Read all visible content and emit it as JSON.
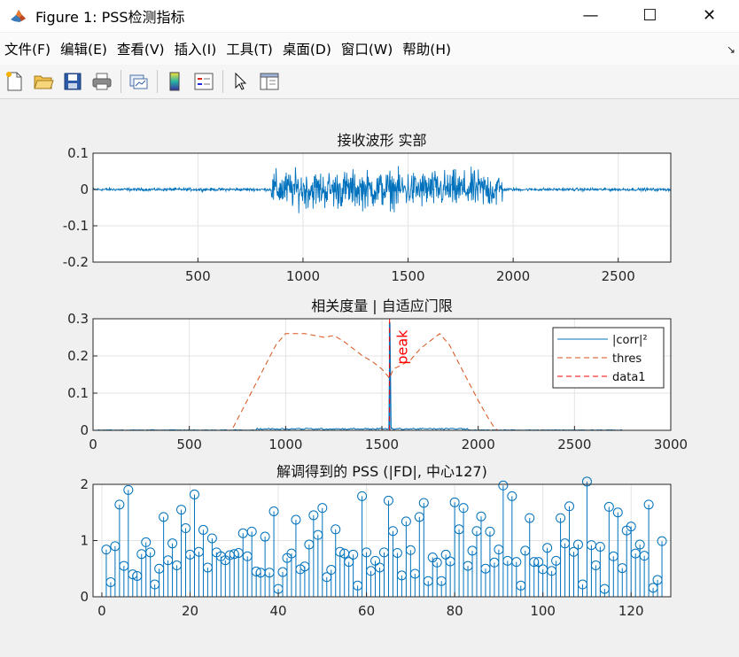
{
  "window": {
    "title": "Figure 1: PSS检测指标",
    "minimize": "—",
    "maximize": "☐",
    "close": "✕"
  },
  "menu": {
    "items": [
      "文件(F)",
      "编辑(E)",
      "查看(V)",
      "插入(I)",
      "工具(T)",
      "桌面(D)",
      "窗口(W)",
      "帮助(H)"
    ],
    "overflow_icon": "↘"
  },
  "toolbar": {
    "icons": [
      "new-figure-icon",
      "open-file-icon",
      "save-icon",
      "print-icon",
      "link-plot-icon",
      "colorbar-icon",
      "legend-icon",
      "pointer-icon",
      "property-editor-icon"
    ]
  },
  "colors": {
    "series_blue": "#0072bd",
    "series_orange": "#d95319",
    "peak_red": "#ff0000",
    "axes_bg": "#ffffff"
  },
  "chart_data": [
    {
      "type": "line",
      "title": "接收波形 实部",
      "xlim": [
        1,
        2750
      ],
      "ylim": [
        -0.2,
        0.1
      ],
      "xticks": [
        500,
        1000,
        1500,
        2000,
        2500
      ],
      "yticks": [
        -0.2,
        -0.1,
        0,
        0.1
      ],
      "xtick_labels": [
        "500",
        "1000",
        "1500",
        "2000",
        "2500"
      ],
      "ytick_labels": [
        "-0.2",
        "-0.1",
        "0",
        "0.1"
      ],
      "grid": true,
      "series": [
        {
          "color": "#0072bd",
          "signal_segments": [
            {
              "x_start": 1,
              "x_end": 850,
              "amplitude": 0.006
            },
            {
              "x_start": 850,
              "x_end": 1950,
              "amplitude": 0.1
            },
            {
              "x_start": 1950,
              "x_end": 2750,
              "amplitude": 0.006
            }
          ]
        }
      ]
    },
    {
      "type": "line",
      "title": "相关度量 | 自适应门限",
      "xlim": [
        0,
        3000
      ],
      "ylim": [
        0,
        0.3
      ],
      "xticks": [
        0,
        500,
        1000,
        1500,
        2000,
        2500,
        3000
      ],
      "yticks": [
        0,
        0.1,
        0.2,
        0.3
      ],
      "xtick_labels": [
        "0",
        "500",
        "1000",
        "1500",
        "2000",
        "2500",
        "3000"
      ],
      "ytick_labels": [
        "0",
        "0.1",
        "0.2",
        "0.3"
      ],
      "grid": true,
      "legend_position": "top-right",
      "legend": [
        "|corr|²",
        "thres",
        "data1"
      ],
      "annotation": {
        "text": "peak",
        "x": 1540,
        "y": 0.27
      },
      "series": [
        {
          "name": "|corr|²",
          "color": "#0072bd",
          "style": "solid",
          "baseline": 0.001,
          "peak": {
            "x": 1540,
            "y": 0.29
          }
        },
        {
          "name": "thres",
          "color": "#d95319",
          "style": "dashed",
          "x": [
            0,
            720,
            760,
            800,
            850,
            900,
            950,
            1000,
            1050,
            1100,
            1150,
            1200,
            1250,
            1300,
            1350,
            1400,
            1450,
            1500,
            1540,
            1560,
            1600,
            1650,
            1700,
            1750,
            1800,
            1850,
            1900,
            1950,
            2000,
            2050,
            2080,
            2100,
            2750
          ],
          "y": [
            0,
            0,
            0.04,
            0.08,
            0.13,
            0.18,
            0.23,
            0.26,
            0.26,
            0.26,
            0.255,
            0.25,
            0.255,
            0.24,
            0.22,
            0.2,
            0.185,
            0.165,
            0.14,
            0.165,
            0.175,
            0.19,
            0.22,
            0.24,
            0.26,
            0.23,
            0.18,
            0.13,
            0.08,
            0.035,
            0.01,
            0,
            0
          ]
        },
        {
          "name": "data1",
          "color": "#ff0000",
          "style": "dashed",
          "x": [
            1540,
            1540
          ],
          "y": [
            0,
            0.3
          ]
        }
      ]
    },
    {
      "type": "stem",
      "title": "解调得到的 PSS (|FD|, 中心127)",
      "xlim": [
        -2,
        129
      ],
      "ylim": [
        0,
        2
      ],
      "xticks": [
        0,
        20,
        40,
        60,
        80,
        100,
        120
      ],
      "yticks": [
        0,
        1,
        2
      ],
      "xtick_labels": [
        "0",
        "20",
        "40",
        "60",
        "80",
        "100",
        "120"
      ],
      "ytick_labels": [
        "0",
        "1",
        "2"
      ],
      "grid": true,
      "color": "#0072bd",
      "x_start": 1,
      "values": [
        0.84,
        0.26,
        0.9,
        1.64,
        0.55,
        1.9,
        0.4,
        0.37,
        0.76,
        0.97,
        0.79,
        0.22,
        0.5,
        1.42,
        0.65,
        0.95,
        0.56,
        1.55,
        1.22,
        0.75,
        1.82,
        0.8,
        1.19,
        0.52,
        1.04,
        0.79,
        0.72,
        0.65,
        0.74,
        0.76,
        0.78,
        1.13,
        0.72,
        1.16,
        0.45,
        0.43,
        1.07,
        0.43,
        1.52,
        0.14,
        0.44,
        0.69,
        0.77,
        1.37,
        0.49,
        0.54,
        0.93,
        1.45,
        1.1,
        1.58,
        0.35,
        0.48,
        1.2,
        0.8,
        0.77,
        0.62,
        0.75,
        0.2,
        1.79,
        0.79,
        0.46,
        0.64,
        0.52,
        0.79,
        1.71,
        1.17,
        0.78,
        0.38,
        1.34,
        0.83,
        0.41,
        1.42,
        1.67,
        0.28,
        0.7,
        0.61,
        0.28,
        0.75,
        0.63,
        1.68,
        1.2,
        1.58,
        0.55,
        0.82,
        1.17,
        1.43,
        0.5,
        1.16,
        0.61,
        0.84,
        1.98,
        0.64,
        1.79,
        0.62,
        0.2,
        0.82,
        1.4,
        0.62,
        0.62,
        0.49,
        0.87,
        0.46,
        0.64,
        1.4,
        0.95,
        1.61,
        0.8,
        0.93,
        0.22,
        2.05,
        0.92,
        0.56,
        0.89,
        0.14,
        1.6,
        0.72,
        1.5,
        0.51,
        1.18,
        1.25,
        0.77,
        0.93,
        0.73,
        1.64,
        0.16,
        0.3,
        0.99
      ]
    }
  ]
}
